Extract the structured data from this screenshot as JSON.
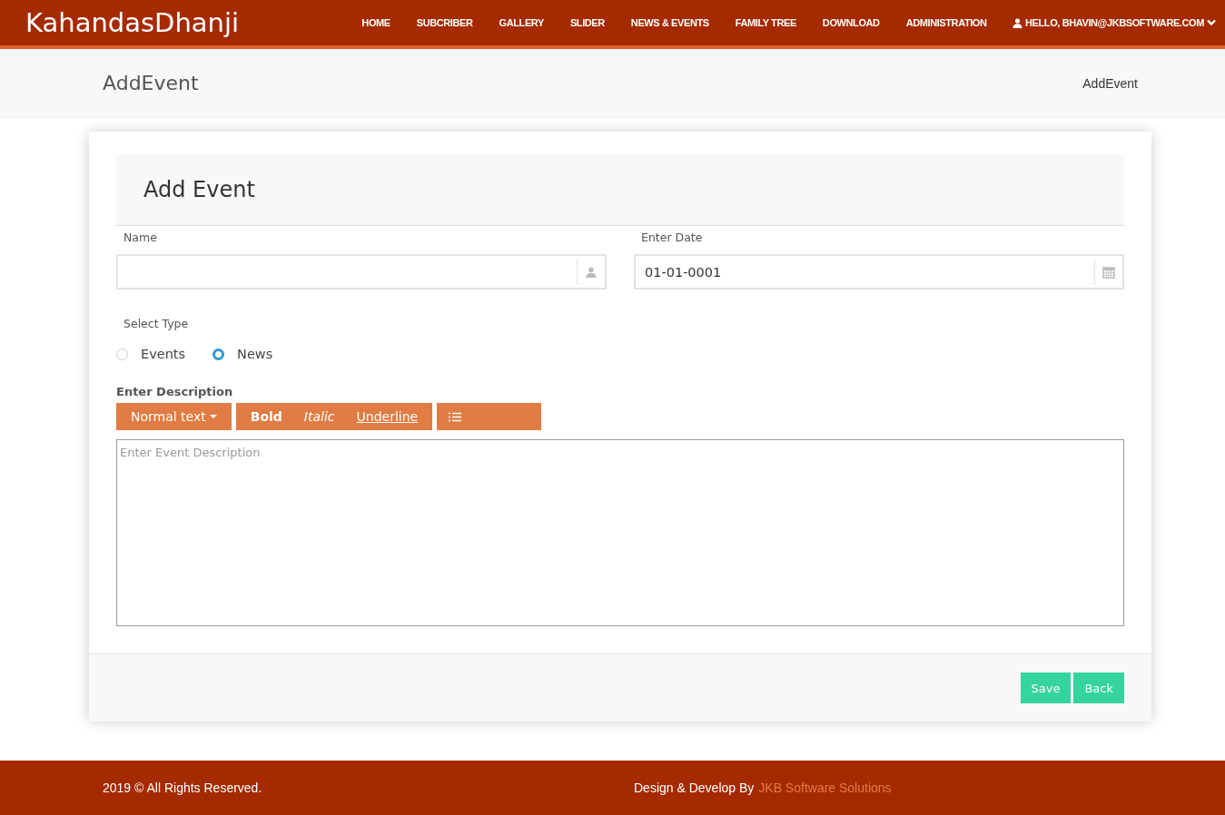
{
  "brand": "KahandasDhanji",
  "nav": [
    {
      "label": "HOME"
    },
    {
      "label": "SUBCRIBER"
    },
    {
      "label": "GALLERY"
    },
    {
      "label": "SLIDER"
    },
    {
      "label": "NEWS & EVENTS"
    },
    {
      "label": "FAMILY TREE"
    },
    {
      "label": "DOWNLOAD"
    },
    {
      "label": "ADMINISTRATION"
    }
  ],
  "user_menu": "HELLO, BHAVIN@JKBSOFTWARE.COM",
  "page_title": "AddEvent",
  "breadcrumb": "AddEvent",
  "form": {
    "title": "Add Event",
    "name_field": {
      "label": "Name"
    },
    "date_field": {
      "label": "Enter Date",
      "value": "01-01-0001"
    },
    "type_label": "Select Type",
    "types": [
      {
        "label": "Events",
        "selected": false
      },
      {
        "label": "News",
        "selected": true
      }
    ],
    "description_label": "Enter Description",
    "toolbar": {
      "style_menu": "Normal text",
      "bold": "Bold",
      "italic": "Italic",
      "underline": "Underline"
    },
    "description_placeholder": "Enter Event Description",
    "buttons": [
      "Save",
      "Back"
    ]
  },
  "footer": {
    "copyright": "2019 © All Rights Reserved.",
    "credit": "Design & Develop By",
    "credit_link": "JKB Software Solutions"
  }
}
